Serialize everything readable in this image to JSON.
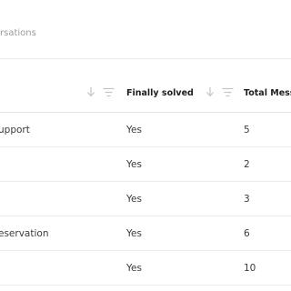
{
  "subtitle": "rsations",
  "table": {
    "columns": [
      {
        "label": ""
      },
      {
        "label": "Finally solved"
      },
      {
        "label": "Total Messa"
      }
    ],
    "rows": [
      {
        "topic": "upport",
        "solved": "Yes",
        "messages": "5"
      },
      {
        "topic": "",
        "solved": "Yes",
        "messages": "2"
      },
      {
        "topic": "",
        "solved": "Yes",
        "messages": "3"
      },
      {
        "topic": "eservation",
        "solved": "Yes",
        "messages": "6"
      },
      {
        "topic": "",
        "solved": "Yes",
        "messages": "10"
      }
    ]
  },
  "icons": {
    "sort": "sort-arrow-down-icon",
    "filter": "filter-icon"
  },
  "colors": {
    "text": "#3a3a3a",
    "header_text": "#1e1e1e",
    "muted": "#9a9a9a",
    "divider": "#ebebeb"
  }
}
